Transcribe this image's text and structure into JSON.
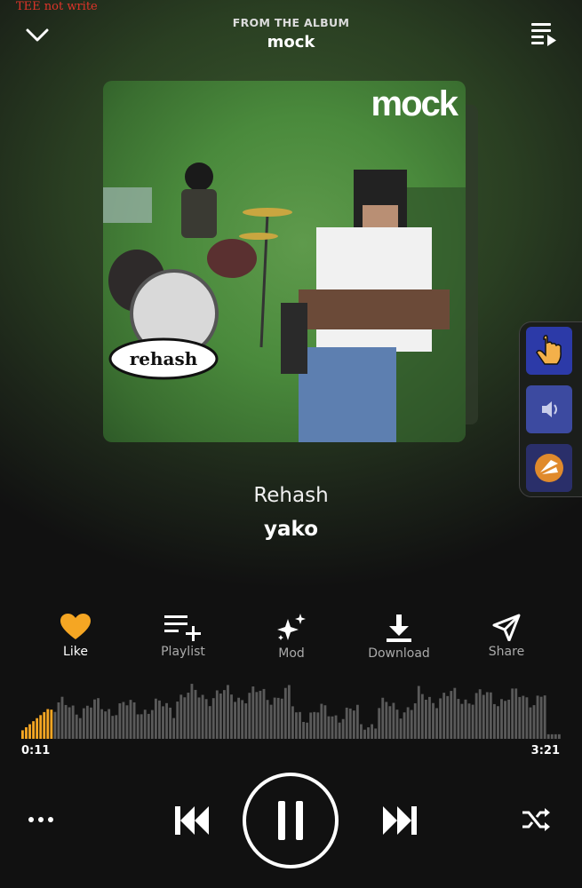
{
  "overlay_caption": "TEE not write",
  "header": {
    "from_label": "FROM THE ALBUM",
    "album": "mock"
  },
  "cover": {
    "title_text": "mock"
  },
  "track": {
    "title": "Rehash",
    "artist": "yako"
  },
  "actions": [
    {
      "label": "Like",
      "icon": "heart-icon",
      "active": true
    },
    {
      "label": "Playlist",
      "icon": "playlist-add-icon"
    },
    {
      "label": "Mod",
      "icon": "sparkle-icon"
    },
    {
      "label": "Download",
      "icon": "download-icon"
    },
    {
      "label": "Share",
      "icon": "send-icon"
    }
  ],
  "player": {
    "elapsed": "0:11",
    "duration": "3:21",
    "progress_fraction": 0.055,
    "state": "playing"
  },
  "colors": {
    "accent": "#f5a623",
    "wave_inactive": "#5a5a5a"
  }
}
